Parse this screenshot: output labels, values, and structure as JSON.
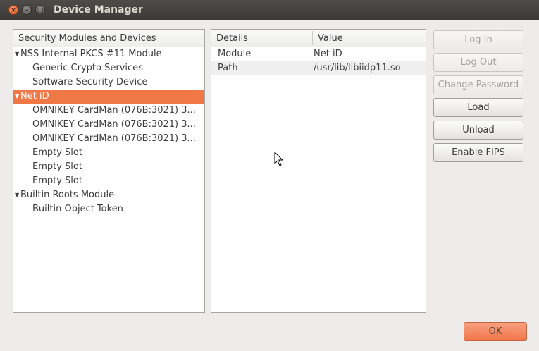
{
  "window": {
    "title": "Device Manager",
    "close_glyph": "×",
    "minimize_glyph": "–",
    "maximize_glyph": "□"
  },
  "tree": {
    "header": "Security Modules and Devices",
    "expand_glyph": "▼",
    "items": [
      {
        "label": "NSS Internal PKCS #11 Module",
        "level": 0,
        "expanded": true
      },
      {
        "label": "Generic Crypto Services",
        "level": 1
      },
      {
        "label": "Software Security Device",
        "level": 1
      },
      {
        "label": "Net iD",
        "level": 0,
        "expanded": true,
        "selected": true
      },
      {
        "label": "OMNIKEY CardMan (076B:3021) 3...",
        "level": 1
      },
      {
        "label": "OMNIKEY CardMan (076B:3021) 3...",
        "level": 1
      },
      {
        "label": "OMNIKEY CardMan (076B:3021) 3...",
        "level": 1
      },
      {
        "label": "Empty Slot",
        "level": 1
      },
      {
        "label": "Empty Slot",
        "level": 1
      },
      {
        "label": "Empty Slot",
        "level": 1
      },
      {
        "label": "Builtin Roots Module",
        "level": 0,
        "expanded": true
      },
      {
        "label": "Builtin Object Token",
        "level": 1
      }
    ]
  },
  "details": {
    "columns": [
      "Details",
      "Value"
    ],
    "rows": [
      {
        "key": "Module",
        "value": "Net iD"
      },
      {
        "key": "Path",
        "value": "/usr/lib/libiidp11.so"
      }
    ]
  },
  "buttons": {
    "log_in": "Log In",
    "log_out": "Log Out",
    "change_password": "Change Password",
    "load": "Load",
    "unload": "Unload",
    "enable_fips": "Enable FIPS",
    "ok": "OK"
  },
  "colors": {
    "selection": "#f07746",
    "ok_button": "#f0764a"
  }
}
